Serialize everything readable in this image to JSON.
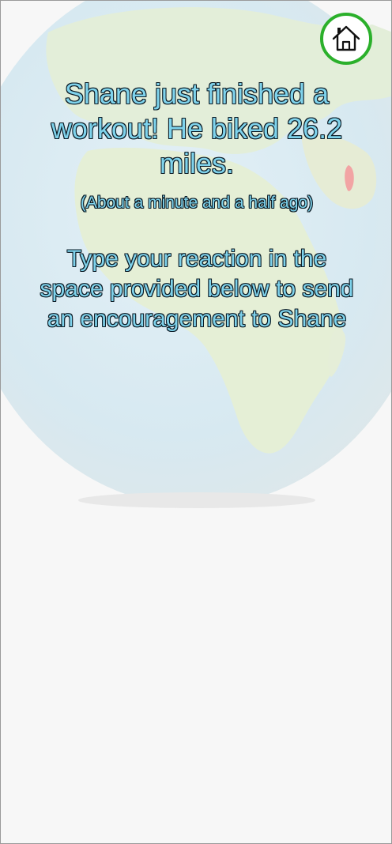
{
  "header": {
    "home_icon": "home-icon",
    "home_button_border_color": "#2bb02b"
  },
  "notification": {
    "headline": "Shane just finished a workout! He biked 26.2 miles.",
    "time_ago": "(About a minute and a half ago)",
    "instruction": "Type your reaction in the space provided below to send an encouragement to Shane"
  },
  "colors": {
    "text_fill": "#7fd3ec",
    "text_outline": "#0b1a24",
    "background": "#f7f7f7"
  }
}
